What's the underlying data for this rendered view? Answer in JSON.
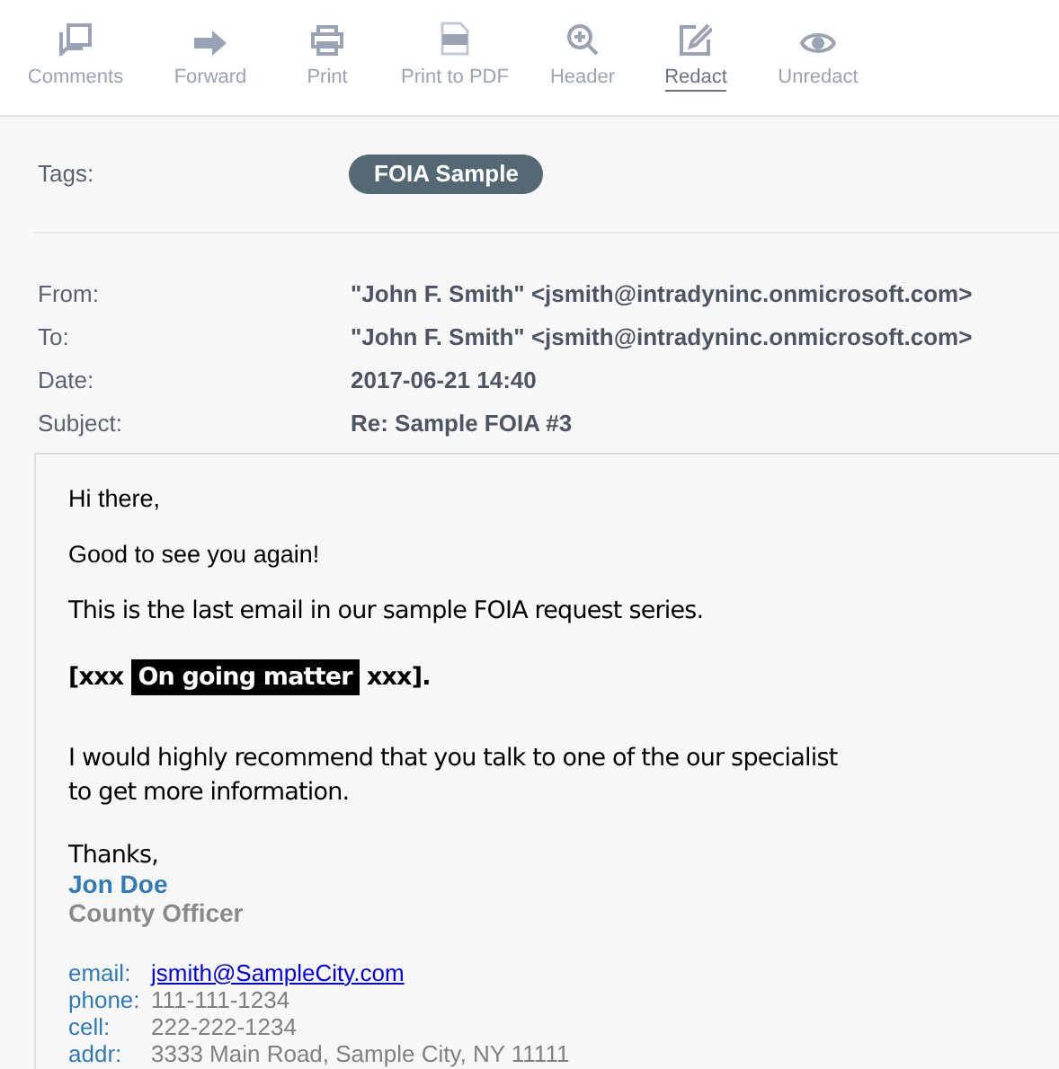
{
  "toolbar": [
    {
      "kind": "comments",
      "label": "Comments",
      "selected": false
    },
    {
      "kind": "forward",
      "label": "Forward",
      "selected": false
    },
    {
      "kind": "print",
      "label": "Print",
      "selected": false
    },
    {
      "kind": "pdf",
      "label": "Print to PDF",
      "selected": false
    },
    {
      "kind": "header",
      "label": "Header",
      "selected": false
    },
    {
      "kind": "redact",
      "label": "Redact",
      "selected": true
    },
    {
      "kind": "unredact",
      "label": "Unredact",
      "selected": false
    }
  ],
  "tags": {
    "label": "Tags:",
    "items": [
      "FOIA Sample"
    ]
  },
  "headers": [
    {
      "label": "From:",
      "value": "\"John F. Smith\" <jsmith@intradyninc.onmicrosoft.com>"
    },
    {
      "label": "To:",
      "value": "\"John F. Smith\" <jsmith@intradyninc.onmicrosoft.com>"
    },
    {
      "label": "Date:",
      "value": "2017-06-21 14:40"
    },
    {
      "label": "Subject:",
      "value": "Re: Sample FOIA #3"
    }
  ],
  "body": [
    {
      "kind": "plain",
      "text": "Hi there,"
    },
    {
      "kind": "plain",
      "text": "Good to see you again!"
    },
    {
      "kind": "serif",
      "text": "This is the last email in our sample FOIA request series."
    },
    {
      "kind": "redaction",
      "before": "[xxx",
      "redacted": "On going matter",
      "after": "xxx]."
    },
    {
      "kind": "serif",
      "text": "I would highly recommend that you talk to one of the our specialist to get more information."
    }
  ],
  "signature": {
    "closing": "Thanks,",
    "name": "Jon Doe",
    "title": "County Officer",
    "contacts": [
      {
        "kind": "link",
        "label": "email:",
        "value": "jsmith@SampleCity.com"
      },
      {
        "kind": "text",
        "label": "phone:",
        "value": "111-111-1234"
      },
      {
        "kind": "text",
        "label": "cell:",
        "value": "222-222-1234"
      },
      {
        "kind": "text",
        "label": "addr:",
        "value": "3333 Main Road, Sample City, NY 11111"
      }
    ]
  }
}
